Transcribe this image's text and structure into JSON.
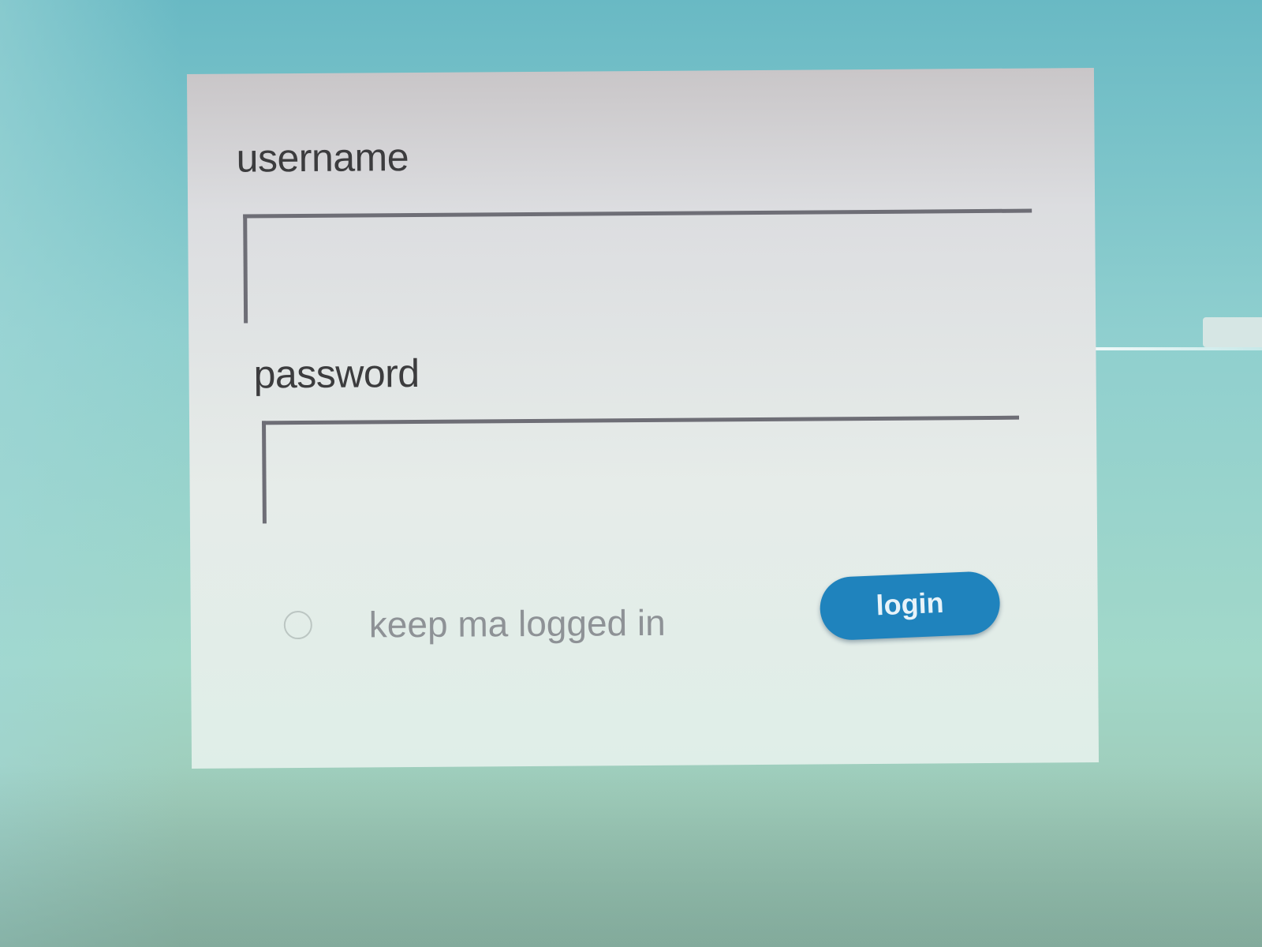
{
  "login_form": {
    "username_label": "username",
    "username_value": "",
    "password_label": "password",
    "password_value": "",
    "remember_label": "keep ma logged in",
    "remember_checked": false,
    "login_label": "login"
  },
  "colors": {
    "background": "#8fcfcf",
    "card": "#e6ece9",
    "button": "#1f83bd"
  }
}
